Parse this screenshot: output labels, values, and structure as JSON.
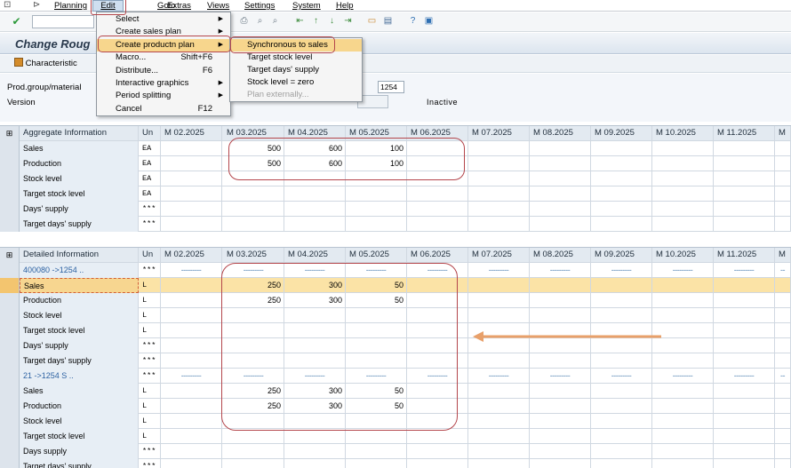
{
  "menubar": {
    "items": [
      "Planning",
      "Edit",
      "Goto",
      "Extras",
      "Views",
      "Settings",
      "System",
      "Help"
    ]
  },
  "window": {
    "title": "Change Roug",
    "characteristic_button": "Characteristic",
    "prod_group_label": "Prod.group/material",
    "prod_group_value": "1254",
    "version_label": "Version",
    "status": "Inactive"
  },
  "edit_menu": {
    "items": [
      {
        "label": "Select",
        "shortcut": "",
        "submenu": true
      },
      {
        "label": "Create sales plan",
        "shortcut": "",
        "submenu": true
      },
      {
        "label": "Create productn plan",
        "shortcut": "",
        "submenu": true
      },
      {
        "label": "Macro...",
        "shortcut": "Shift+F6",
        "submenu": false
      },
      {
        "label": "Distribute...",
        "shortcut": "F6",
        "submenu": false
      },
      {
        "label": "Interactive graphics",
        "shortcut": "",
        "submenu": true
      },
      {
        "label": "Period splitting",
        "shortcut": "",
        "submenu": true
      },
      {
        "label": "Cancel",
        "shortcut": "F12",
        "submenu": false
      }
    ]
  },
  "submenu": {
    "items": [
      {
        "label": "Synchronous to sales",
        "disabled": false
      },
      {
        "label": "Target stock level",
        "disabled": false
      },
      {
        "label": "Target days' supply",
        "disabled": false
      },
      {
        "label": "Stock level = zero",
        "disabled": false
      },
      {
        "label": "Plan externally...",
        "disabled": true
      }
    ]
  },
  "periods": [
    "M 02.2025",
    "M 03.2025",
    "M 04.2025",
    "M 05.2025",
    "M 06.2025",
    "M 07.2025",
    "M 08.2025",
    "M 09.2025",
    "M 10.2025",
    "M 11.2025",
    "M"
  ],
  "aggregate": {
    "header": "Aggregate Information",
    "unit_header": "Un",
    "rows": [
      {
        "label": "Sales",
        "unit": "EA",
        "values": [
          "",
          "500",
          "600",
          "100",
          "",
          "",
          "",
          "",
          "",
          "",
          ""
        ]
      },
      {
        "label": "Production",
        "unit": "EA",
        "values": [
          "",
          "500",
          "600",
          "100",
          "",
          "",
          "",
          "",
          "",
          "",
          ""
        ]
      },
      {
        "label": "Stock level",
        "unit": "EA",
        "values": [
          "",
          "",
          "",
          "",
          "",
          "",
          "",
          "",
          "",
          "",
          ""
        ]
      },
      {
        "label": "Target stock level",
        "unit": "EA",
        "values": [
          "",
          "",
          "",
          "",
          "",
          "",
          "",
          "",
          "",
          "",
          ""
        ]
      },
      {
        "label": "Days' supply",
        "unit": "***",
        "values": [
          "",
          "",
          "",
          "",
          "",
          "",
          "",
          "",
          "",
          "",
          ""
        ]
      },
      {
        "label": "Target days' supply",
        "unit": "***",
        "values": [
          "",
          "",
          "",
          "",
          "",
          "",
          "",
          "",
          "",
          "",
          ""
        ]
      }
    ]
  },
  "detailed": {
    "header": "Detailed Information",
    "unit_header": "Un",
    "rows": [
      {
        "label": "400080          ->1254     ..",
        "unit": "***",
        "values": [
          "---------",
          "---------",
          "---------",
          "---------",
          "---------",
          "---------",
          "---------",
          "---------",
          "---------",
          "---------",
          "--"
        ],
        "type": "group"
      },
      {
        "label": "Sales",
        "unit": "L",
        "values": [
          "",
          "250",
          "300",
          "50",
          "",
          "",
          "",
          "",
          "",
          "",
          ""
        ],
        "type": "highlight"
      },
      {
        "label": "Production",
        "unit": "L",
        "values": [
          "",
          "250",
          "300",
          "50",
          "",
          "",
          "",
          "",
          "",
          "",
          ""
        ],
        "type": "normal"
      },
      {
        "label": "Stock level",
        "unit": "L",
        "values": [
          "",
          "",
          "",
          "",
          "",
          "",
          "",
          "",
          "",
          "",
          ""
        ],
        "type": "normal"
      },
      {
        "label": "Target stock level",
        "unit": "L",
        "values": [
          "",
          "",
          "",
          "",
          "",
          "",
          "",
          "",
          "",
          "",
          ""
        ],
        "type": "normal"
      },
      {
        "label": "Days' supply",
        "unit": "***",
        "values": [
          "",
          "",
          "",
          "",
          "",
          "",
          "",
          "",
          "",
          "",
          ""
        ],
        "type": "normal"
      },
      {
        "label": "Target days' supply",
        "unit": "***",
        "values": [
          "",
          "",
          "",
          "",
          "",
          "",
          "",
          "",
          "",
          "",
          ""
        ],
        "type": "normal"
      },
      {
        "label": "21              ->1254    S ..",
        "unit": "***",
        "values": [
          "---------",
          "---------",
          "---------",
          "---------",
          "---------",
          "---------",
          "---------",
          "---------",
          "---------",
          "---------",
          "--"
        ],
        "type": "group"
      },
      {
        "label": "Sales",
        "unit": "L",
        "values": [
          "",
          "250",
          "300",
          "50",
          "",
          "",
          "",
          "",
          "",
          "",
          ""
        ],
        "type": "normal"
      },
      {
        "label": "Production",
        "unit": "L",
        "values": [
          "",
          "250",
          "300",
          "50",
          "",
          "",
          "",
          "",
          "",
          "",
          ""
        ],
        "type": "normal"
      },
      {
        "label": "Stock level",
        "unit": "L",
        "values": [
          "",
          "",
          "",
          "",
          "",
          "",
          "",
          "",
          "",
          "",
          ""
        ],
        "type": "normal"
      },
      {
        "label": "Target stock level",
        "unit": "L",
        "values": [
          "",
          "",
          "",
          "",
          "",
          "",
          "",
          "",
          "",
          "",
          ""
        ],
        "type": "normal"
      },
      {
        "label": "Days supply",
        "unit": "***",
        "values": [
          "",
          "",
          "",
          "",
          "",
          "",
          "",
          "",
          "",
          "",
          ""
        ],
        "type": "normal"
      },
      {
        "label": "Target days' supply",
        "unit": "***",
        "values": [
          "",
          "",
          "",
          "",
          "",
          "",
          "",
          "",
          "",
          "",
          ""
        ],
        "type": "normal"
      }
    ]
  },
  "colors": {
    "annotation_red": "#b4464c",
    "annotation_arrow": "#e8a06a",
    "highlight_row": "#fbe3a6"
  }
}
